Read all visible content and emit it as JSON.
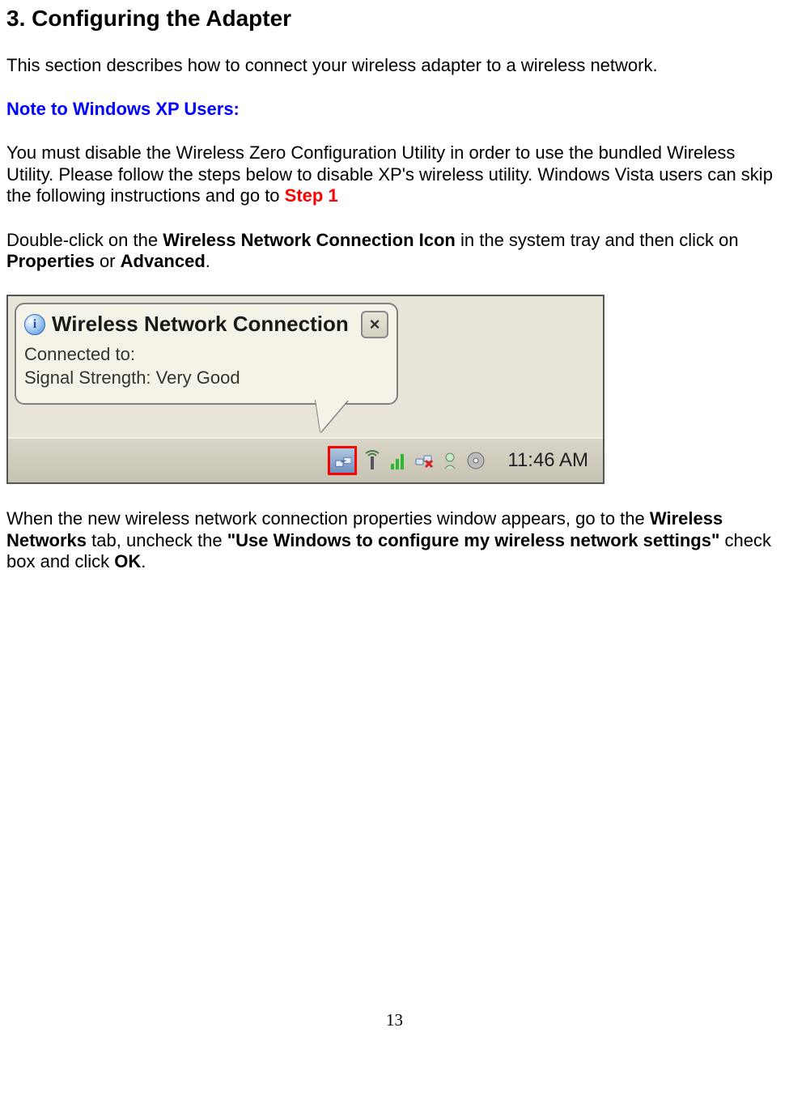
{
  "heading": "3. Configuring the Adapter",
  "intro": "This section describes how to connect your wireless adapter to a wireless network.",
  "note_heading": "Note to Windows XP Users:",
  "p1_a": "You must disable the Wireless Zero Configuration Utility in order to use the bundled Wireless Utility.  Please follow the steps below to disable XP's wireless utility.  Windows Vista users can skip the following instructions and go to ",
  "p1_step": "Step 1",
  "p2_a": "Double-click on the ",
  "p2_b": "Wireless Network Connection Icon",
  "p2_c": " in the system tray and then click on ",
  "p2_d": "Properties",
  "p2_e": " or ",
  "p2_f": "Advanced",
  "p2_g": ".",
  "tooltip": {
    "title": "Wireless Network Connection",
    "line1": "Connected to:",
    "line2": "Signal Strength: Very Good",
    "close_label": "×"
  },
  "taskbar": {
    "clock": "11:46 AM"
  },
  "p3_a": "When the new wireless network connection properties window appears, go to the ",
  "p3_b": "Wireless Networks",
  "p3_c": " tab, uncheck the ",
  "p3_d": "\"Use Windows to configure my wireless network settings\"",
  "p3_e": " check box and click ",
  "p3_f": "OK",
  "p3_g": ".",
  "page_number": "13"
}
